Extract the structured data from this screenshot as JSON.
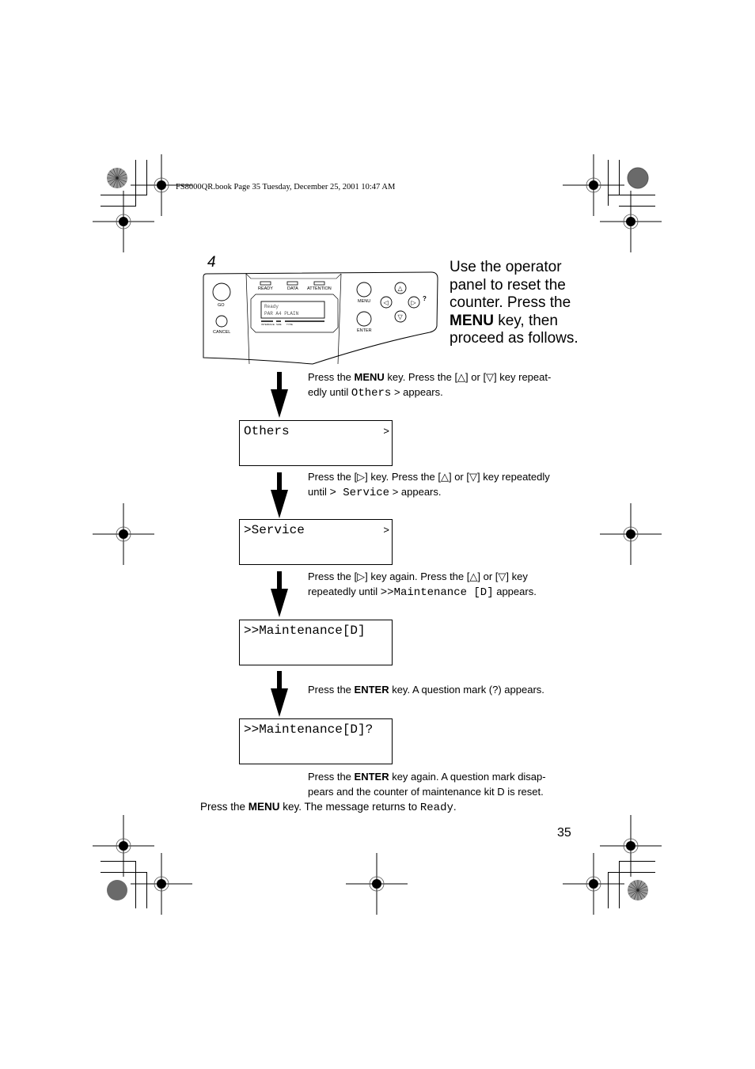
{
  "header": {
    "running_head": "FS8000QR.book  Page 35  Tuesday, December 25, 2001  10:47 AM"
  },
  "step": {
    "number": "4",
    "intro_pre": "Use the operator panel to reset the counter.  Press the ",
    "intro_bold": "MENU",
    "intro_post": " key, then proceed as follows."
  },
  "operator_panel": {
    "indicators": [
      "READY",
      "DATA",
      "ATTENTION"
    ],
    "display_line1": "Ready",
    "display_line2": "PAR A4 PLAIN",
    "display_labels": [
      "INTERFACE",
      "SIZE",
      "TYPE"
    ],
    "buttons": {
      "go": "GO",
      "cancel": "CANCEL",
      "menu": "MENU",
      "enter": "ENTER",
      "help": "?"
    },
    "arrow_keys": {
      "up": "△",
      "down": "▽",
      "left": "◁",
      "right": "▷"
    }
  },
  "flow": [
    {
      "instruction": {
        "parts": [
          {
            "t": "Press the "
          },
          {
            "t": "MENU",
            "b": true
          },
          {
            "t": " key.  Press the  [△] or [▽] key repeat-"
          },
          {
            "br": true
          },
          {
            "t": "edly until "
          },
          {
            "t": "Others",
            "m": true
          },
          {
            "t": "  > appears."
          }
        ]
      },
      "display": {
        "text": "Others",
        "suffix": ">"
      }
    },
    {
      "instruction": {
        "parts": [
          {
            "t": "Press the [▷] key. Press the [△] or [▽] key repeatedly"
          },
          {
            "br": true
          },
          {
            "t": "until "
          },
          {
            "t": "> Service",
            "m": true
          },
          {
            "t": "  > appears."
          }
        ]
      },
      "display": {
        "text": ">Service",
        "suffix": ">"
      }
    },
    {
      "instruction": {
        "parts": [
          {
            "t": "Press the [▷] key again.  Press the [△] or [▽] key"
          },
          {
            "br": true
          },
          {
            "t": "repeatedly until "
          },
          {
            "t": ">>Maintenance [D]",
            "m": true
          },
          {
            "t": "  appears."
          }
        ]
      },
      "display": {
        "text": ">>Maintenance[D]",
        "suffix": ""
      }
    },
    {
      "instruction": {
        "parts": [
          {
            "t": "Press the "
          },
          {
            "t": "ENTER",
            "b": true
          },
          {
            "t": " key.  A question mark (?) appears."
          }
        ]
      },
      "display": {
        "text": ">>Maintenance[D]?",
        "suffix": ""
      }
    }
  ],
  "after_flow": {
    "parts": [
      {
        "t": "Press the "
      },
      {
        "t": "ENTER",
        "b": true
      },
      {
        "t": " key again.  A question mark disap-"
      },
      {
        "br": true
      },
      {
        "t": "pears and the counter of maintenance kit D is reset."
      }
    ]
  },
  "final_note": {
    "pre": "Press the ",
    "bold": "MENU",
    "mid": " key.  The message returns to ",
    "mono": "Ready",
    "post": "."
  },
  "page_number": "35"
}
